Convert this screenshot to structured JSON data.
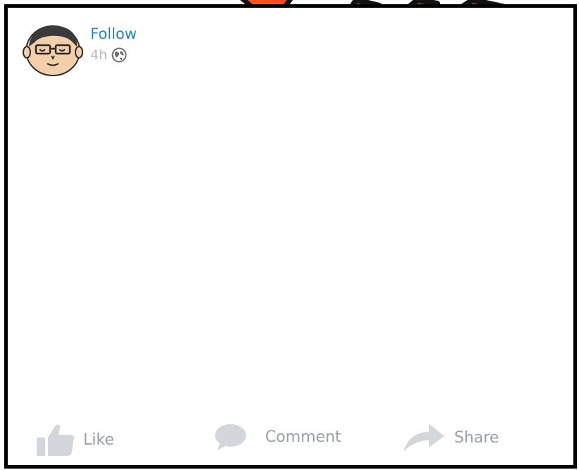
{
  "post": {
    "follow_label": "Follow",
    "time": "4h",
    "avatar_icon": "cartoon-face-with-glasses",
    "privacy_icon": "globe-icon"
  },
  "actions": {
    "like": "Like",
    "comment": "Comment",
    "share": "Share"
  },
  "colors": {
    "link": "#2a86c6",
    "muted_text": "#b9bcc2",
    "action_text": "#9aa0a8",
    "action_icon": "#d3d6db",
    "frame": "#000000",
    "logo_orange": "#ff6a1a",
    "logo_red": "#ff2a2a"
  }
}
